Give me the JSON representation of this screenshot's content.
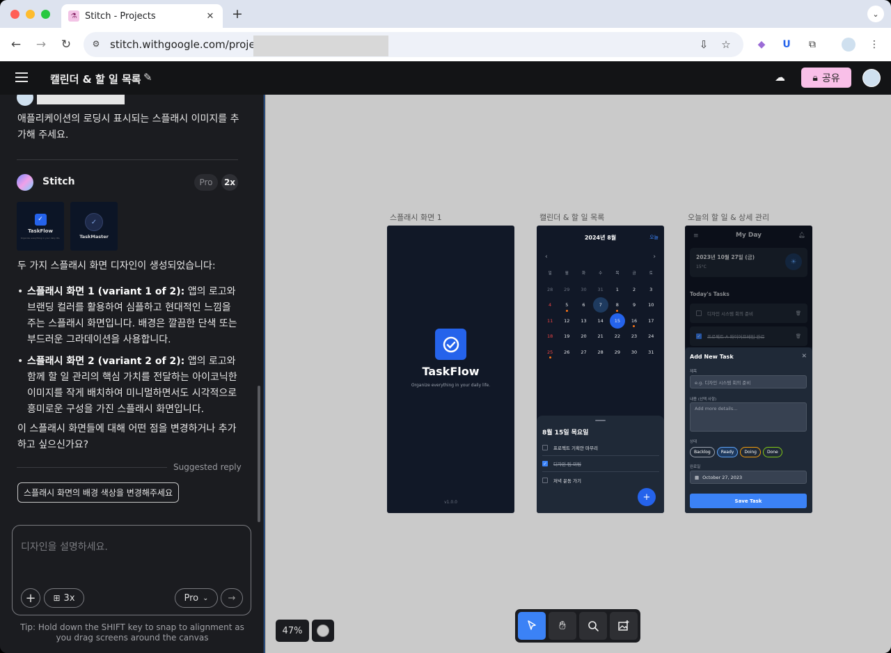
{
  "browser": {
    "tab_title": "Stitch - Projects",
    "tab_favicon": "flask-icon",
    "url": "stitch.withgoogle.com/projects"
  },
  "header": {
    "title": "캘린더 & 할 일 목록",
    "share_label": "공유"
  },
  "chat": {
    "user_message": "애플리케이션의 로딩시 표시되는 스플래시 이미지를 추가해 주세요.",
    "assistant_name": "Stitch",
    "pro_label": "Pro",
    "multiplier_label": "2x",
    "thumbnails": [
      {
        "name": "TaskFlow",
        "sub": "Organize everything in your daily life."
      },
      {
        "name": "TaskMaster",
        "sub": ""
      }
    ],
    "intro": "두 가지 스플래시 화면 디자인이 생성되었습니다:",
    "items": [
      {
        "title": "스플래시 화면 1 (variant 1 of 2):",
        "text": " 앱의 로고와 브랜딩 컬러를 활용하여 심플하고 현대적인 느낌을 주는 스플래시 화면입니다. 배경은 깔끔한 단색 또는 부드러운 그라데이션을 사용합니다."
      },
      {
        "title": "스플래시 화면 2 (variant 2 of 2):",
        "text": " 앱의 로고와 함께 할 일 관리의 핵심 가치를 전달하는 아이코닉한 이미지를 작게 배치하여 미니멀하면서도 시각적으로 흥미로운 구성을 가진 스플래시 화면입니다."
      }
    ],
    "question": "이 스플래시 화면들에 대해 어떤 점을 변경하거나 추가하고 싶으신가요?",
    "suggested_label": "Suggested reply",
    "suggested_reply": "스플래시 화면의 배경 색상을 변경해주세요"
  },
  "composer": {
    "placeholder": "디자인을 설명하세요.",
    "variants_label": "3x",
    "model_label": "Pro",
    "tip": "Tip: Hold down the SHIFT key to snap to alignment as you drag screens around the canvas"
  },
  "canvas": {
    "zoom": "47%",
    "frames": [
      {
        "label": "스플래시 화면 1"
      },
      {
        "label": "캘린더 & 할 일 목록"
      },
      {
        "label": "오늘의 할 일 & 상세 관리"
      }
    ]
  },
  "splash": {
    "app_name": "TaskFlow",
    "tagline": "Organize everything in your daily life.",
    "version": "v1.0.0"
  },
  "calendar": {
    "title": "2024년 8월",
    "today_label": "오늘",
    "weekdays": [
      "일",
      "월",
      "화",
      "수",
      "목",
      "금",
      "토"
    ],
    "weeks": [
      [
        {
          "d": "28",
          "dim": true
        },
        {
          "d": "29",
          "dim": true
        },
        {
          "d": "30",
          "dim": true
        },
        {
          "d": "31",
          "dim": true
        },
        {
          "d": "1"
        },
        {
          "d": "2"
        },
        {
          "d": "3"
        }
      ],
      [
        {
          "d": "4"
        },
        {
          "d": "5",
          "dot": true
        },
        {
          "d": "6"
        },
        {
          "d": "7",
          "mark": true
        },
        {
          "d": "8",
          "dot": true
        },
        {
          "d": "9"
        },
        {
          "d": "10"
        }
      ],
      [
        {
          "d": "11"
        },
        {
          "d": "12"
        },
        {
          "d": "13"
        },
        {
          "d": "14"
        },
        {
          "d": "15",
          "sel": true
        },
        {
          "d": "16",
          "dot": true
        },
        {
          "d": "17"
        }
      ],
      [
        {
          "d": "18"
        },
        {
          "d": "19"
        },
        {
          "d": "20"
        },
        {
          "d": "21"
        },
        {
          "d": "22"
        },
        {
          "d": "23"
        },
        {
          "d": "24"
        }
      ],
      [
        {
          "d": "25",
          "dot": true
        },
        {
          "d": "26"
        },
        {
          "d": "27"
        },
        {
          "d": "28"
        },
        {
          "d": "29"
        },
        {
          "d": "30"
        },
        {
          "d": "31"
        }
      ]
    ],
    "day_title": "8월 15일 목요일",
    "tasks": [
      {
        "text": "프로젝트 기획안 마무리",
        "done": false
      },
      {
        "text": "디자인 팀 미팅",
        "done": true
      },
      {
        "text": "저녁 운동 가기",
        "done": false
      }
    ]
  },
  "myday": {
    "title": "My Day",
    "date": "2023년 10월 27일 (금)",
    "temp": "15°C",
    "section": "Today's Tasks",
    "tasks": [
      {
        "text": "디자인 시스템 회의 준비",
        "done": false
      },
      {
        "text": "프로젝트 A 와이어프레임 완료",
        "done": true
      }
    ],
    "modal": {
      "title": "Add New Task",
      "title_label": "제목",
      "title_placeholder": "e.g. 디자인 시스템 회의 준비",
      "content_label": "내용 (선택 사항)",
      "content_placeholder": "Add more details...",
      "status_label": "상태",
      "statuses": [
        {
          "label": "Backlog",
          "color": "#9ca3af"
        },
        {
          "label": "Ready",
          "color": "#60a5fa"
        },
        {
          "label": "Doing",
          "color": "#f59e0b"
        },
        {
          "label": "Done",
          "color": "#84cc16"
        }
      ],
      "due_label": "완료일",
      "due_value": "October 27, 2023",
      "save_label": "Save Task"
    }
  }
}
